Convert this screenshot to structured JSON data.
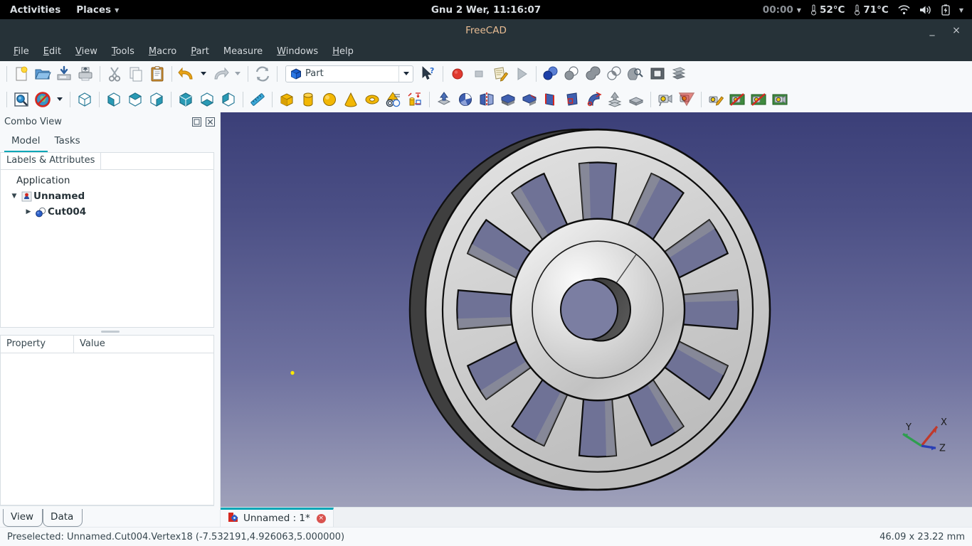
{
  "gnome_bar": {
    "activities": "Activities",
    "places": "Places",
    "places_caret": "chevron-down-icon",
    "clock": "Gnu  2 Wer, 11:16:07",
    "timer": "00:00",
    "timer_caret": "chevron-down-icon",
    "temp1": "52°C",
    "temp2": "71°C",
    "wifi_icon": "wifi-icon",
    "volume_icon": "volume-icon",
    "battery_icon": "battery-charging-icon",
    "system_caret": "chevron-down-icon"
  },
  "titlebar": {
    "title": "FreeCAD",
    "minimize": "_",
    "close": "×"
  },
  "menubar": {
    "items": [
      {
        "label": "File",
        "mnemonic": "F",
        "rest": "ile"
      },
      {
        "label": "Edit",
        "mnemonic": "E",
        "rest": "dit"
      },
      {
        "label": "View",
        "mnemonic": "V",
        "rest": "iew"
      },
      {
        "label": "Tools",
        "mnemonic": "T",
        "rest": "ools"
      },
      {
        "label": "Macro",
        "mnemonic": "M",
        "rest": "acro"
      },
      {
        "label": "Part",
        "mnemonic": "P",
        "rest": "art"
      },
      {
        "label": "Measure",
        "mnemonic": "",
        "rest": "Measure"
      },
      {
        "label": "Windows",
        "mnemonic": "W",
        "rest": "indows"
      },
      {
        "label": "Help",
        "mnemonic": "H",
        "rest": "elp"
      }
    ]
  },
  "toolbar1": {
    "buttons": [
      {
        "name": "new-document-icon",
        "tip": "New"
      },
      {
        "name": "open-document-icon",
        "tip": "Open"
      },
      {
        "name": "save-document-icon",
        "tip": "Save"
      },
      {
        "name": "print-icon",
        "tip": "Print"
      },
      {
        "name": "cut-icon",
        "tip": "Cut"
      },
      {
        "name": "copy-icon",
        "tip": "Copy"
      },
      {
        "name": "paste-icon",
        "tip": "Paste"
      },
      {
        "name": "undo-icon",
        "tip": "Undo"
      },
      {
        "name": "undo-dropdown-icon",
        "tip": "Undo history"
      },
      {
        "name": "redo-icon",
        "tip": "Redo"
      },
      {
        "name": "redo-dropdown-icon",
        "tip": "Redo history"
      },
      {
        "name": "refresh-icon",
        "tip": "Refresh"
      }
    ],
    "workbench": {
      "label": "Part",
      "icon": "part-workbench-icon",
      "arrow": "chevron-down-icon"
    },
    "whats_this": "whats-this-icon",
    "macro": [
      {
        "name": "macro-record-icon",
        "tip": "Macro recording"
      },
      {
        "name": "macro-stop-icon",
        "tip": "Stop macro recording"
      },
      {
        "name": "macro-edit-icon",
        "tip": "Macros"
      },
      {
        "name": "macro-execute-icon",
        "tip": "Execute macro"
      }
    ],
    "boolean": [
      {
        "name": "boolean-icon",
        "tip": "Boolean"
      },
      {
        "name": "cut-solid-icon",
        "tip": "Cut"
      },
      {
        "name": "union-icon",
        "tip": "Union"
      },
      {
        "name": "common-icon",
        "tip": "Intersection"
      },
      {
        "name": "check-geometry-icon",
        "tip": "Check geometry"
      },
      {
        "name": "section-icon",
        "tip": "Section"
      },
      {
        "name": "cross-sections-icon",
        "tip": "Cross-sections"
      }
    ]
  },
  "toolbar2": {
    "groups": [
      [
        {
          "name": "fit-all-icon"
        },
        {
          "name": "draw-style-icon"
        },
        {
          "name": "draw-style-dropdown-icon"
        }
      ],
      [
        {
          "name": "isometric-view-icon"
        }
      ],
      [
        {
          "name": "front-view-icon"
        },
        {
          "name": "top-view-icon"
        },
        {
          "name": "right-view-icon"
        }
      ],
      [
        {
          "name": "rear-view-icon"
        },
        {
          "name": "bottom-view-icon"
        },
        {
          "name": "left-view-icon"
        }
      ],
      [
        {
          "name": "measure-icon"
        }
      ],
      [
        {
          "name": "box-primitive-icon"
        },
        {
          "name": "cylinder-primitive-icon"
        },
        {
          "name": "sphere-primitive-icon"
        },
        {
          "name": "cone-primitive-icon"
        },
        {
          "name": "torus-primitive-icon"
        },
        {
          "name": "shape-builder-icon"
        },
        {
          "name": "primitives-icon"
        }
      ],
      [
        {
          "name": "extrude-icon"
        },
        {
          "name": "revolve-icon"
        },
        {
          "name": "mirror-icon"
        },
        {
          "name": "fillet-icon"
        },
        {
          "name": "chamfer-icon"
        },
        {
          "name": "ruled-surface-icon"
        },
        {
          "name": "loft-icon"
        },
        {
          "name": "sweep-icon"
        },
        {
          "name": "offset-icon"
        },
        {
          "name": "thickness-icon"
        }
      ],
      [
        {
          "name": "camera-icon"
        },
        {
          "name": "clipping-plane-icon"
        }
      ],
      [
        {
          "name": "scene-edit-icon"
        },
        {
          "name": "texture-off-icon"
        },
        {
          "name": "shadow-off-icon"
        },
        {
          "name": "render-icon"
        }
      ]
    ]
  },
  "combo_view": {
    "title": "Combo View",
    "float_icon": "float-panel-icon",
    "close_icon": "close-panel-icon",
    "tabs": [
      {
        "label": "Model",
        "active": true
      },
      {
        "label": "Tasks",
        "active": false
      }
    ],
    "tree_header": "Labels & Attributes",
    "tree": [
      {
        "label": "Application",
        "level": 0,
        "arrow": "",
        "icon": "",
        "bold": false
      },
      {
        "label": "Unnamed",
        "level": 1,
        "arrow": "expanded-arrow-icon",
        "icon": "document-icon",
        "bold": true
      },
      {
        "label": "Cut004",
        "level": 2,
        "arrow": "collapsed-arrow-icon",
        "icon": "boolean-cut-icon",
        "bold": true
      }
    ],
    "property_headers": [
      "Property",
      "Value"
    ],
    "bottom_tabs": [
      {
        "label": "View"
      },
      {
        "label": "Data"
      }
    ]
  },
  "document_tab": {
    "icon": "freecad-document-icon",
    "label": "Unnamed : 1*",
    "close": "×"
  },
  "statusbar": {
    "message": "Preselected: Unnamed.Cut004.Vertex18 (-7.532191,4.926063,5.000000)",
    "dimensions": "46.09 x 23.22 mm"
  },
  "viewport": {
    "axis_labels": {
      "x": "X",
      "y": "Y",
      "z": "Z"
    },
    "axis_colors": {
      "x": "#c0392b",
      "y": "#2e9e4f",
      "z": "#2a3fb5"
    },
    "background_top": "#3b3f78",
    "background_bottom": "#9b9db8",
    "model_name": "wheel-pulley-model",
    "model_face_color": "#cfcfcf",
    "model_edge_color": "#101010",
    "spoke_count": 12
  }
}
